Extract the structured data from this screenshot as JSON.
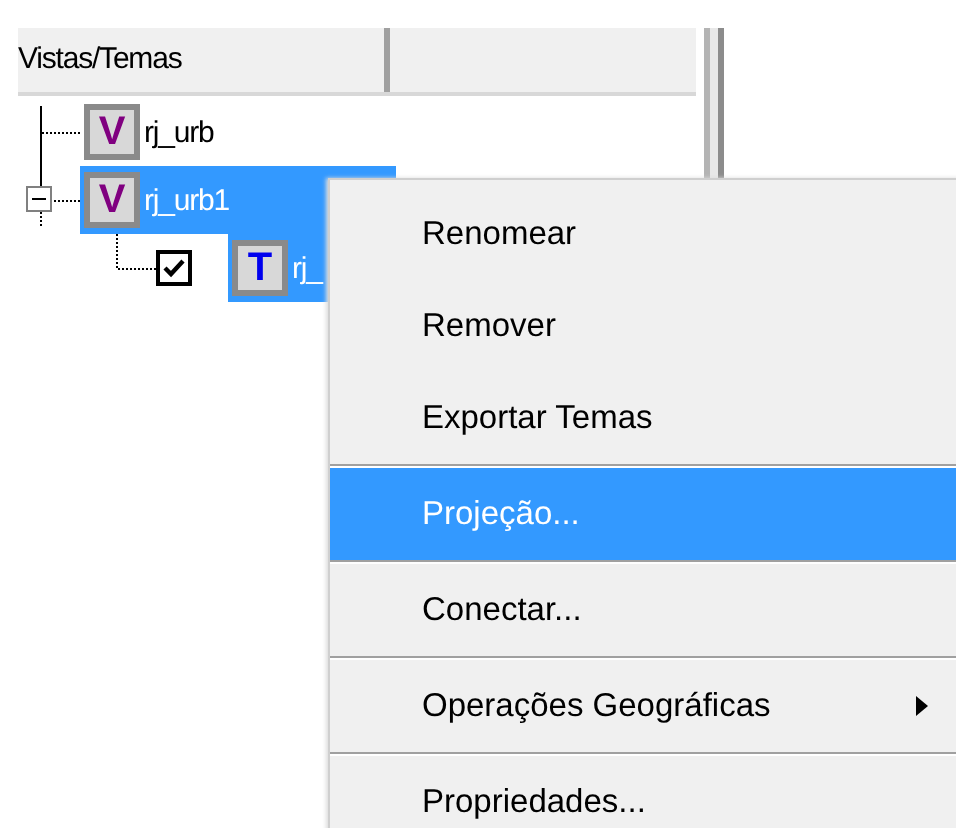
{
  "tree": {
    "columns": [
      "Vistas/Temas"
    ],
    "items": [
      {
        "kind": "view",
        "icon": "V",
        "label": "rj_urb",
        "selected": false
      },
      {
        "kind": "view",
        "icon": "V",
        "label": "rj_urb1",
        "selected": true,
        "expanded": true,
        "children": [
          {
            "kind": "theme",
            "icon": "T",
            "label": "rj_",
            "selected": true,
            "checked": true
          }
        ]
      }
    ]
  },
  "context_menu": {
    "items": [
      {
        "label": "Renomear",
        "selected": false
      },
      {
        "label": "Remover",
        "selected": false
      },
      {
        "label": "Exportar Temas",
        "selected": false
      },
      {
        "label": "Projeção...",
        "selected": true,
        "separator_before": true
      },
      {
        "label": "Conectar...",
        "selected": false,
        "separator_before": true
      },
      {
        "label": "Operações Geográficas",
        "selected": false,
        "separator_before": true,
        "submenu": true
      },
      {
        "label": "Propriedades...",
        "selected": false,
        "separator_before": true
      }
    ]
  }
}
